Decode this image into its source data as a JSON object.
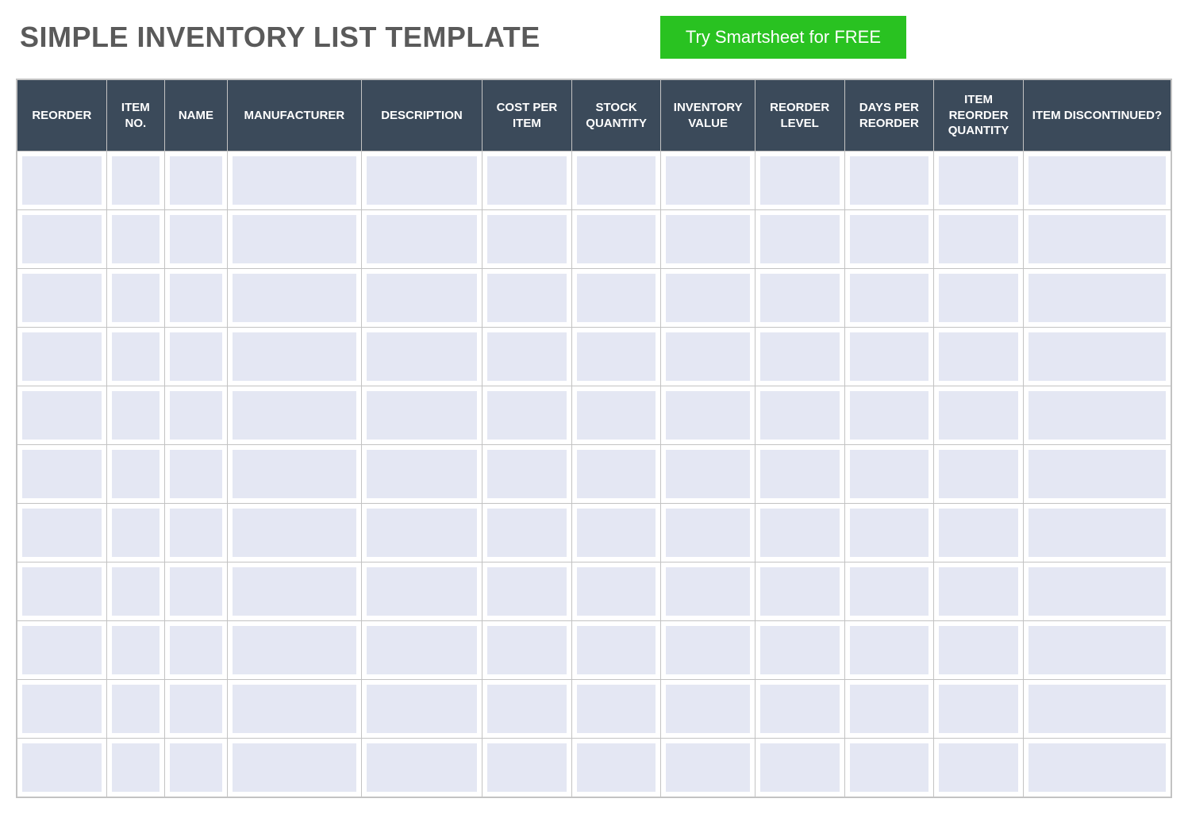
{
  "header": {
    "title": "SIMPLE INVENTORY LIST TEMPLATE",
    "cta_label": "Try Smartsheet for FREE"
  },
  "table": {
    "columns": [
      {
        "label": "REORDER",
        "class": "col-reorder"
      },
      {
        "label": "ITEM NO.",
        "class": "col-itemno"
      },
      {
        "label": "NAME",
        "class": "col-name"
      },
      {
        "label": "MANUFACTURER",
        "class": "col-manufacturer"
      },
      {
        "label": "DESCRIPTION",
        "class": "col-description"
      },
      {
        "label": "COST PER ITEM",
        "class": "col-costperitem"
      },
      {
        "label": "STOCK QUANTITY",
        "class": "col-stockqty"
      },
      {
        "label": "INVENTORY VALUE",
        "class": "col-invvalue"
      },
      {
        "label": "REORDER LEVEL",
        "class": "col-reorderlevel"
      },
      {
        "label": "DAYS PER REORDER",
        "class": "col-daysper"
      },
      {
        "label": "ITEM REORDER QUANTITY",
        "class": "col-itemreorderqty"
      },
      {
        "label": "ITEM DISCONTINUED?",
        "class": "col-discontinued"
      }
    ],
    "rows": [
      [
        "",
        "",
        "",
        "",
        "",
        "",
        "",
        "",
        "",
        "",
        "",
        ""
      ],
      [
        "",
        "",
        "",
        "",
        "",
        "",
        "",
        "",
        "",
        "",
        "",
        ""
      ],
      [
        "",
        "",
        "",
        "",
        "",
        "",
        "",
        "",
        "",
        "",
        "",
        ""
      ],
      [
        "",
        "",
        "",
        "",
        "",
        "",
        "",
        "",
        "",
        "",
        "",
        ""
      ],
      [
        "",
        "",
        "",
        "",
        "",
        "",
        "",
        "",
        "",
        "",
        "",
        ""
      ],
      [
        "",
        "",
        "",
        "",
        "",
        "",
        "",
        "",
        "",
        "",
        "",
        ""
      ],
      [
        "",
        "",
        "",
        "",
        "",
        "",
        "",
        "",
        "",
        "",
        "",
        ""
      ],
      [
        "",
        "",
        "",
        "",
        "",
        "",
        "",
        "",
        "",
        "",
        "",
        ""
      ],
      [
        "",
        "",
        "",
        "",
        "",
        "",
        "",
        "",
        "",
        "",
        "",
        ""
      ],
      [
        "",
        "",
        "",
        "",
        "",
        "",
        "",
        "",
        "",
        "",
        "",
        ""
      ],
      [
        "",
        "",
        "",
        "",
        "",
        "",
        "",
        "",
        "",
        "",
        "",
        ""
      ]
    ]
  }
}
